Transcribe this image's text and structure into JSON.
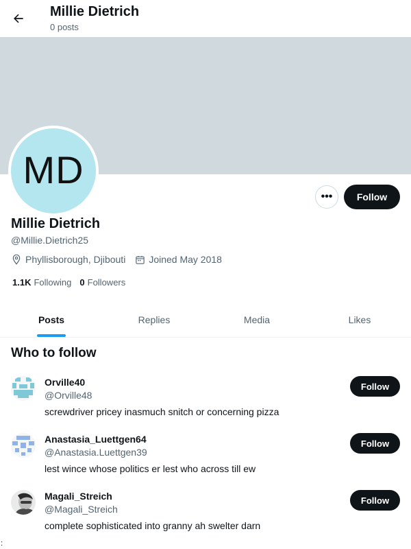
{
  "header": {
    "title": "Millie Dietrich",
    "subtitle": "0 posts"
  },
  "profile": {
    "avatar_initials": "MD",
    "avatar_color": "#b3e6ee",
    "banner_color": "#cfd9de",
    "name": "Millie Dietrich",
    "handle": "@Millie.Dietrich25",
    "location": "Phyllisborough, Djibouti",
    "joined": "Joined May 2018",
    "following_count": "1.1K",
    "following_label": "Following",
    "followers_count": "0",
    "followers_label": "Followers",
    "more_label": "•••",
    "follow_label": "Follow"
  },
  "tabs": [
    {
      "label": "Posts",
      "active": true
    },
    {
      "label": "Replies",
      "active": false
    },
    {
      "label": "Media",
      "active": false
    },
    {
      "label": "Likes",
      "active": false
    }
  ],
  "who_to_follow": {
    "title": "Who to follow",
    "suggestions": [
      {
        "name": "Orville40",
        "handle": "@Orville48",
        "bio": "screwdriver pricey inasmuch snitch or concerning pizza",
        "follow_label": "Follow"
      },
      {
        "name": "Anastasia_Luettgen64",
        "handle": "@Anastasia.Luettgen39",
        "bio": "lest wince whose politics er lest who across till ew",
        "follow_label": "Follow"
      },
      {
        "name": "Magali_Streich",
        "handle": "@Magali_Streich",
        "bio": "complete sophisticated into granny ah swelter darn",
        "follow_label": "Follow"
      }
    ]
  },
  "colors": {
    "accent": "#1d9bf0",
    "button_dark": "#0f1419",
    "secondary_text": "#536471"
  },
  "edge_mark": ":"
}
